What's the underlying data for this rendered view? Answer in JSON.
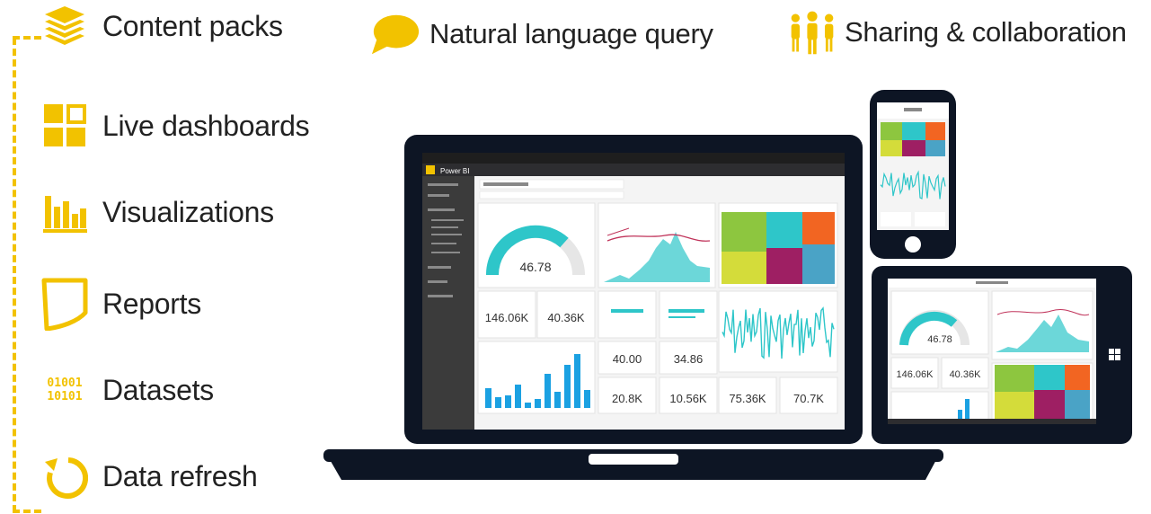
{
  "features": [
    {
      "label": "Content packs",
      "icon": "layers-icon"
    },
    {
      "label": "Live dashboards",
      "icon": "dashboard-tiles-icon"
    },
    {
      "label": "Visualizations",
      "icon": "bar-chart-icon"
    },
    {
      "label": "Reports",
      "icon": "report-page-icon"
    },
    {
      "label": "Datasets",
      "icon": "binary-data-icon",
      "binary_lines": [
        "01001",
        "10101"
      ]
    },
    {
      "label": "Data refresh",
      "icon": "refresh-icon"
    }
  ],
  "top_features": [
    {
      "label": "Natural language query",
      "icon": "speech-bubble-icon"
    },
    {
      "label": "Sharing & collaboration",
      "icon": "people-icon"
    }
  ],
  "colors": {
    "accent": "#f2c200",
    "device": "#0d1524",
    "teal": "#2ec6c9",
    "bar_blue": "#1ba1e2",
    "tree_green": "#8dc63f",
    "tree_yellow": "#d4dc3a",
    "tree_orange": "#f26522",
    "tree_maroon": "#9e1f63",
    "tree_teal": "#2ec6c9"
  },
  "laptop_screen": {
    "app_title": "Power BI",
    "gauge_value": "46.78",
    "cards": [
      "146.06K",
      "40.36K",
      "40.00",
      "34.86",
      "20.8K",
      "10.56K",
      "75.36K",
      "70.7K"
    ]
  },
  "tablet_screen": {
    "gauge_value": "46.78",
    "cards": [
      "146.06K",
      "40.36K"
    ]
  }
}
